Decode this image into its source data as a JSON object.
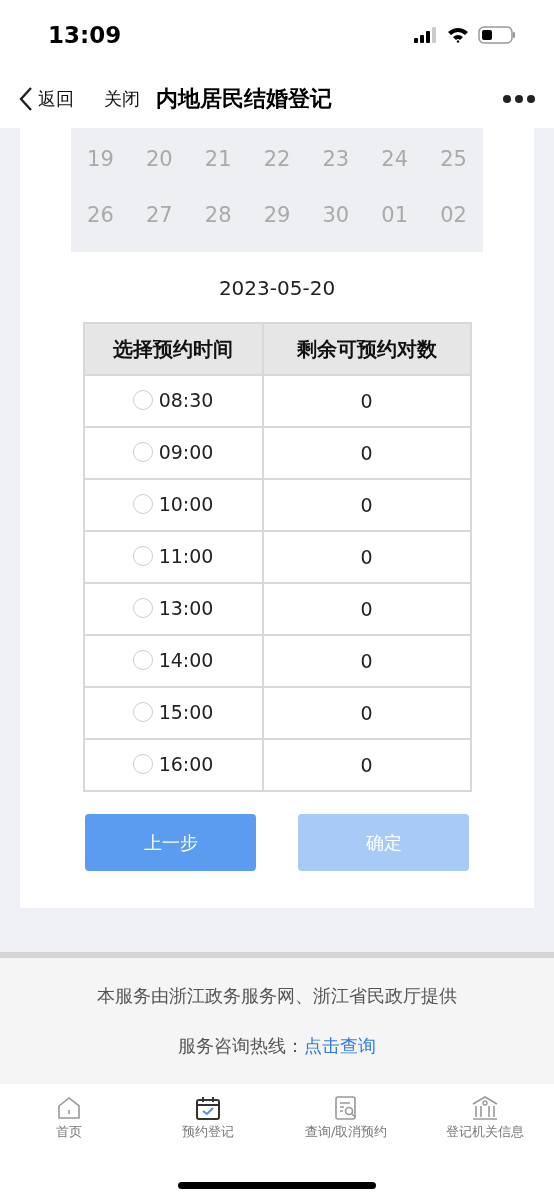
{
  "status_bar": {
    "time": "13:09"
  },
  "nav": {
    "back": "返回",
    "close": "关闭",
    "title": "内地居民结婚登记"
  },
  "calendar": {
    "weeks": [
      [
        "19",
        "20",
        "21",
        "22",
        "23",
        "24",
        "25"
      ],
      [
        "26",
        "27",
        "28",
        "29",
        "30",
        "01",
        "02"
      ]
    ]
  },
  "selected_date": "2023-05-20",
  "table": {
    "columns": [
      "选择预约时间",
      "剩余可预约对数"
    ],
    "rows": [
      {
        "time": "08:30",
        "remaining": "0",
        "selected": false
      },
      {
        "time": "09:00",
        "remaining": "0",
        "selected": false
      },
      {
        "time": "10:00",
        "remaining": "0",
        "selected": false
      },
      {
        "time": "11:00",
        "remaining": "0",
        "selected": false
      },
      {
        "time": "13:00",
        "remaining": "0",
        "selected": false
      },
      {
        "time": "14:00",
        "remaining": "0",
        "selected": false
      },
      {
        "time": "15:00",
        "remaining": "0",
        "selected": false
      },
      {
        "time": "16:00",
        "remaining": "0",
        "selected": false
      }
    ]
  },
  "buttons": [
    {
      "label": "上一步",
      "disabled": false
    },
    {
      "label": "确定",
      "disabled": true
    }
  ],
  "footer": {
    "provider": "本服务由浙江政务服务网、浙江省民政厅提供",
    "hotline_label": "服务咨询热线：",
    "hotline_link": "点击查询"
  },
  "tab_bar": [
    {
      "kind": "home",
      "label": "首页",
      "selected": false
    },
    {
      "kind": "calendar",
      "label": "预约登记",
      "selected": true
    },
    {
      "kind": "search",
      "label": "查询/取消预约",
      "selected": false
    },
    {
      "kind": "building",
      "label": "登记机关信息",
      "selected": false
    }
  ]
}
